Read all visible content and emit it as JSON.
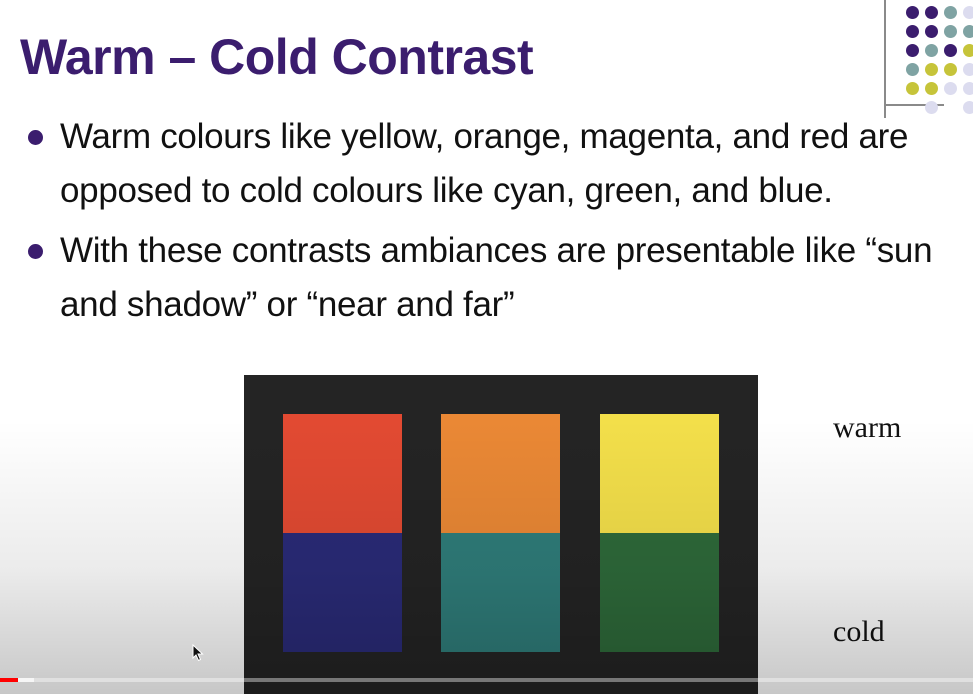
{
  "slide": {
    "title": "Warm – Cold Contrast",
    "bullets": [
      "Warm colours like yellow, orange, magenta, and red are opposed to cold colours like cyan, green, and blue.",
      "With these contrasts ambiances are presentable like “sun and shadow” or “near and far”"
    ],
    "labels": {
      "warm": "warm",
      "cold": "cold"
    }
  },
  "colors": {
    "title": "#3b1d6e",
    "bullet": "#3b1d6e",
    "panel": "#242424",
    "warm_swatches": [
      "#e24a32",
      "#ea8835",
      "#f3df4a"
    ],
    "cold_swatches": [
      "#2a2b78",
      "#2f7d7a",
      "#2e6a3a"
    ],
    "decor_dots": {
      "purple": "#3b1d6e",
      "teal": "#7fa3a3",
      "yellow": "#c6c43a",
      "lavender": "#dcdcef"
    }
  },
  "video": {
    "progress_fraction": 0.018,
    "buffer_fraction": 0.035
  }
}
